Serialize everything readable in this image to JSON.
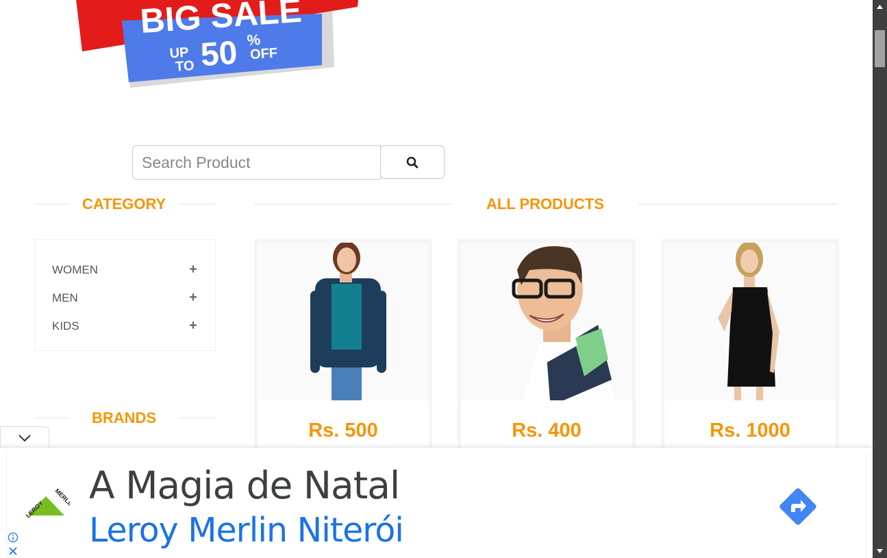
{
  "banner": {
    "headline": "BIG SALE",
    "up": "UP",
    "to": "TO",
    "percent_value": "50",
    "percent_sign": "%",
    "off": "OFF",
    "colors": {
      "red": "#e41b1b",
      "blue": "#4f7bea"
    }
  },
  "search": {
    "placeholder": "Search Product",
    "value": "",
    "icon": "search-icon"
  },
  "category": {
    "heading": "CATEGORY",
    "items": [
      {
        "label": "WOMEN",
        "icon": "plus-icon"
      },
      {
        "label": "MEN",
        "icon": "plus-icon"
      },
      {
        "label": "KIDS",
        "icon": "plus-icon"
      }
    ]
  },
  "brands": {
    "heading": "BRANDS"
  },
  "products": {
    "heading": "ALL PRODUCTS",
    "items": [
      {
        "price": "Rs. 500"
      },
      {
        "price": "Rs. 400"
      },
      {
        "price": "Rs. 1000"
      }
    ]
  },
  "ad": {
    "title": "A Magia de Natal",
    "subtitle": "Leroy Merlin Niterói",
    "logo_text": "LEROY MERLIN",
    "icons": [
      "chevron-down-icon",
      "directions-icon",
      "info-icon",
      "close-icon"
    ]
  },
  "colors": {
    "accent": "#f89406",
    "ad_blue": "#1a73e8",
    "leroy_green": "#78be20"
  }
}
